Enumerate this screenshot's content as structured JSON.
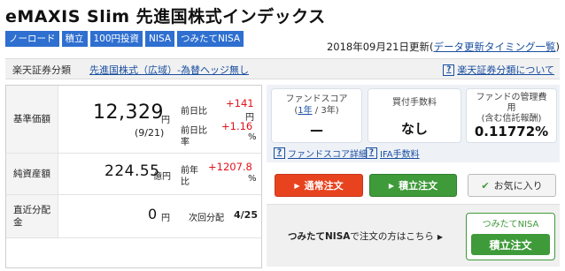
{
  "fund": {
    "name": "eMAXIS Slim 先進国株式インデックス",
    "tags": [
      "ノーロード",
      "積立",
      "100円投資",
      "NISA",
      "つみたてNISA"
    ]
  },
  "updated": {
    "date_text": "2018年09月21日更新(",
    "link": "データ更新タイミング一覧",
    "close": ")"
  },
  "category": {
    "label": "楽天証券分類",
    "value": "先進国株式（広域）-為替ヘッジ無し",
    "about_link": "楽天証券分類について"
  },
  "stats": {
    "nav": {
      "label": "基準価額",
      "value": "12,329",
      "unit": "円",
      "date": "(9/21)",
      "change_label": "前日比",
      "change_value": "+141",
      "change_unit": "円",
      "rate_label_1": "前日比",
      "rate_label_2": "率",
      "rate_value": "+1.16",
      "rate_unit": "%"
    },
    "net_assets": {
      "label": "純資産額",
      "value": "224.55",
      "unit": "億円",
      "change_label_1": "前年",
      "change_label_2": "比",
      "change_value": "+1207.8",
      "change_unit": "%"
    },
    "distribution": {
      "label_1": "直近分配",
      "label_2": "金",
      "value": "0",
      "unit": "円",
      "next_label": "次回分配",
      "next_value": "4/25"
    }
  },
  "cards": {
    "score": {
      "title": "ファンドスコア",
      "open": "(",
      "year1": "1年",
      "sep": " / ",
      "year3": "3年",
      "close": ")",
      "value": "—"
    },
    "buy_fee": {
      "title": "買付手数料",
      "value": "なし"
    },
    "mgmt_fee": {
      "title_1": "ファンドの管理費",
      "title_2": "用",
      "title_3": "(含む信託報酬)",
      "value": "0.11772%"
    }
  },
  "links": {
    "score_detail": "ファンドスコア詳細",
    "ifa_fee": "IFA手数料"
  },
  "buttons": {
    "regular_order": "通常注文",
    "accumulation_order": "積立注文",
    "favorite": "お気に入り"
  },
  "nisa": {
    "prompt_bold": "つみたてNISA",
    "prompt_rest": "で注文の方はこちら",
    "badge": "つみたてNISA",
    "button": "積立注文"
  },
  "colors": {
    "tag_blue": "#2e6fd0",
    "link_blue": "#1a4fa0",
    "red_value": "#e0121b",
    "order_red": "#e8431f",
    "order_green": "#3f9a3a"
  }
}
